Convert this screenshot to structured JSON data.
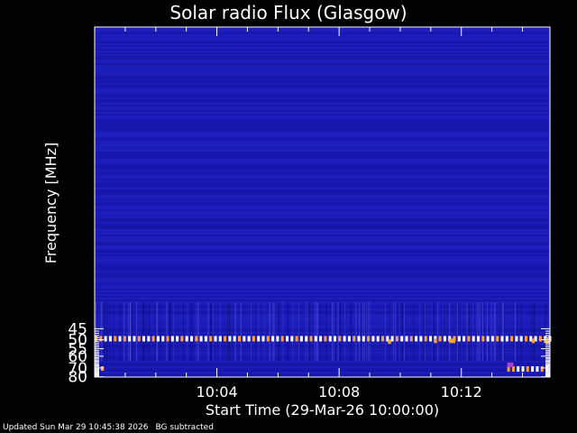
{
  "chart_data": {
    "type": "heatmap",
    "title": "Solar radio Flux (Glasgow)",
    "xlabel": "Start Time (29-Mar-26 10:00:00)",
    "ylabel": "Frequency [MHz]",
    "x_tick_labels": [
      "10:04",
      "10:08",
      "10:12"
    ],
    "x_ticks_minutes": [
      4,
      8,
      12
    ],
    "xlim_minutes": [
      0,
      14.9
    ],
    "y_tick_labels": [
      "45",
      "50",
      "55",
      "60",
      "70",
      "80"
    ],
    "y_ticks_mhz": [
      45,
      50,
      55,
      60,
      70,
      80
    ],
    "ylim_mhz": [
      80,
      45
    ],
    "yscale": "reciprocal",
    "features": [
      {
        "type": "band",
        "freq_mhz": 49.5,
        "x_start_min": 0,
        "x_end_min": 14.9,
        "style": "dashed-white-orange"
      },
      {
        "type": "spot",
        "freq_mhz": 71.0,
        "x_start_min": 0.2,
        "x_end_min": 0.3
      },
      {
        "type": "band",
        "freq_mhz": 71.0,
        "x_start_min": 13.5,
        "x_end_min": 14.9,
        "style": "dashed-white-orange"
      },
      {
        "type": "spot",
        "freq_mhz": 51.2,
        "x_start_min": 9.6,
        "x_end_min": 9.7
      },
      {
        "type": "spot",
        "freq_mhz": 50.8,
        "x_start_min": 11.1,
        "x_end_min": 11.2
      },
      {
        "type": "spot",
        "freq_mhz": 50.8,
        "x_start_min": 11.6,
        "x_end_min": 11.8
      },
      {
        "type": "spot",
        "freq_mhz": 50.8,
        "x_start_min": 14.3,
        "x_end_min": 14.4
      },
      {
        "type": "spot",
        "freq_mhz": 50.8,
        "x_start_min": 14.7,
        "x_end_min": 14.9
      },
      {
        "type": "spot-faint",
        "freq_mhz": 67.5,
        "x_start_min": 13.5,
        "x_end_min": 13.7
      }
    ],
    "colors": {
      "background": "#1a1ab4",
      "band_light": "#ffffff",
      "band_warm": "#ffa030",
      "axes": "#ffffff"
    }
  },
  "footer": {
    "updated": "Updated Sun Mar 29 10:45:38 2026",
    "note": "BG subtracted"
  }
}
